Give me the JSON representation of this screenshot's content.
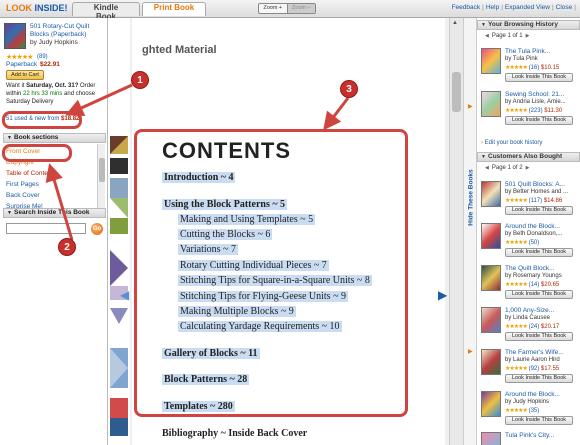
{
  "app": {
    "logo_look": "LOOK",
    "logo_inside": " INSIDE!",
    "tabs": [
      "Kindle Book",
      "Print Book"
    ],
    "zoom": {
      "label": "Zoom +",
      "minus": "Zoom –"
    },
    "toplinks": [
      "Feedback",
      "|",
      "Help",
      "|",
      "Expanded View",
      "|",
      "Close",
      "|"
    ]
  },
  "book": {
    "title": "501 Rotary-Cut Quilt Blocks (Paperback)",
    "author": "by Judy Hopkins",
    "stars": "★★★★★",
    "rating_count": "(89)",
    "format": "Paperback",
    "price": "$22.91",
    "add_to_cart": "Add to Cart",
    "ship_prefix": "Want it ",
    "ship_date": "Saturday, Oct. 31?",
    "ship_order": " Order within ",
    "ship_time": "22 hrs 33 mins",
    "ship_suffix": " and choose Saturday Delivery",
    "used_new": "51 used & new from ",
    "used_price": "$18.82"
  },
  "sections": {
    "heading": "Book sections",
    "items": [
      "Front Cover",
      "Copyright",
      "Table of Contents",
      "First Pages",
      "Back Cover",
      "Surprise Me!"
    ]
  },
  "search": {
    "heading": "Search Inside This Book",
    "value": "",
    "go": "Go"
  },
  "page": {
    "prev_title": "ghted Material",
    "contents_title": "CONTENTS",
    "toc": [
      {
        "text": "Introduction  ~  4",
        "bold": true,
        "indent": false
      },
      {
        "text": "Using the Block Patterns  ~  5",
        "bold": true,
        "indent": false
      },
      {
        "text": "Making and Using Templates  ~  5",
        "bold": false,
        "indent": true
      },
      {
        "text": "Cutting the Blocks  ~  6",
        "bold": false,
        "indent": true
      },
      {
        "text": "Variations  ~  7",
        "bold": false,
        "indent": true
      },
      {
        "text": "Rotary Cutting Individual Pieces  ~  7",
        "bold": false,
        "indent": true
      },
      {
        "text": "Stitching Tips for Square-in-a-Square Units  ~  8",
        "bold": false,
        "indent": true
      },
      {
        "text": "Stitching Tips for Flying-Geese Units  ~  9",
        "bold": false,
        "indent": true
      },
      {
        "text": "Making Multiple Blocks  ~  9",
        "bold": false,
        "indent": true
      },
      {
        "text": "Calculating Yardage Requirements  ~  10",
        "bold": false,
        "indent": true
      },
      {
        "text": "Gallery of Blocks  ~  11",
        "bold": true,
        "indent": false
      },
      {
        "text": "Block Patterns  ~  28",
        "bold": true,
        "indent": false
      },
      {
        "text": "Templates  ~  280",
        "bold": true,
        "indent": false
      },
      {
        "text": "Bibliography  ~  Inside Back Cover",
        "bold": true,
        "indent": false
      }
    ]
  },
  "side_tab": "Hide These Books",
  "history": {
    "heading": "Your Browsing History",
    "pager": "Page 1 of 1",
    "items": [
      {
        "title": "The Tula Pink...",
        "author": "by Tula Pink",
        "stars": "★★★★★",
        "count": "(16)",
        "price": "$10.15",
        "button": "Look Inside This Book"
      },
      {
        "title": "Sewing School: 21...",
        "author": "by Andria Lisle, Amie...",
        "stars": "★★★★★",
        "count": "(223)",
        "price": "$11.30",
        "button": "Look Inside This Book"
      }
    ],
    "edit_link": "Edit your book history"
  },
  "also_bought": {
    "heading": "Customers Also Bought",
    "pager": "Page 1 of 2",
    "items": [
      {
        "title": "501 Quilt Blocks: A...",
        "author": "by Better Homes and ...",
        "stars": "★★★★★",
        "count": "(117)",
        "price": "$14.86",
        "button": "Look Inside This Book"
      },
      {
        "title": "Around the Block...",
        "author": "by Beth Donaldson,...",
        "stars": "★★★★★",
        "count": "(50)",
        "price": "",
        "button": "Look Inside This Book"
      },
      {
        "title": "The Quilt Block...",
        "author": "by Rosemary Youngs",
        "stars": "★★★★★",
        "count": "(14)",
        "price": "$20.65",
        "button": "Look Inside This Book"
      },
      {
        "title": "1,000 Any-Size...",
        "author": "by Linda Causee",
        "stars": "★★★★★",
        "count": "(24)",
        "price": "$20.17",
        "button": "Look Inside This Book"
      },
      {
        "title": "The Farmer's Wife...",
        "author": "by Laurie Aaron Hird",
        "stars": "★★★★★",
        "count": "(92)",
        "price": "$17.55",
        "button": "Look Inside This Book"
      },
      {
        "title": "Around the Block...",
        "author": "by Judy Hopkins",
        "stars": "★★★★★",
        "count": "(35)",
        "price": "",
        "button": "Look Inside This Book"
      },
      {
        "title": "Tula Pink's City...",
        "author": "",
        "stars": "",
        "count": "",
        "price": "",
        "button": ""
      }
    ]
  },
  "callouts": [
    "1",
    "2",
    "3"
  ],
  "colors": {
    "accent": "#e47911",
    "link": "#1a5aa6",
    "callout": "#d0443f",
    "highlight": "#c9dcf2"
  }
}
